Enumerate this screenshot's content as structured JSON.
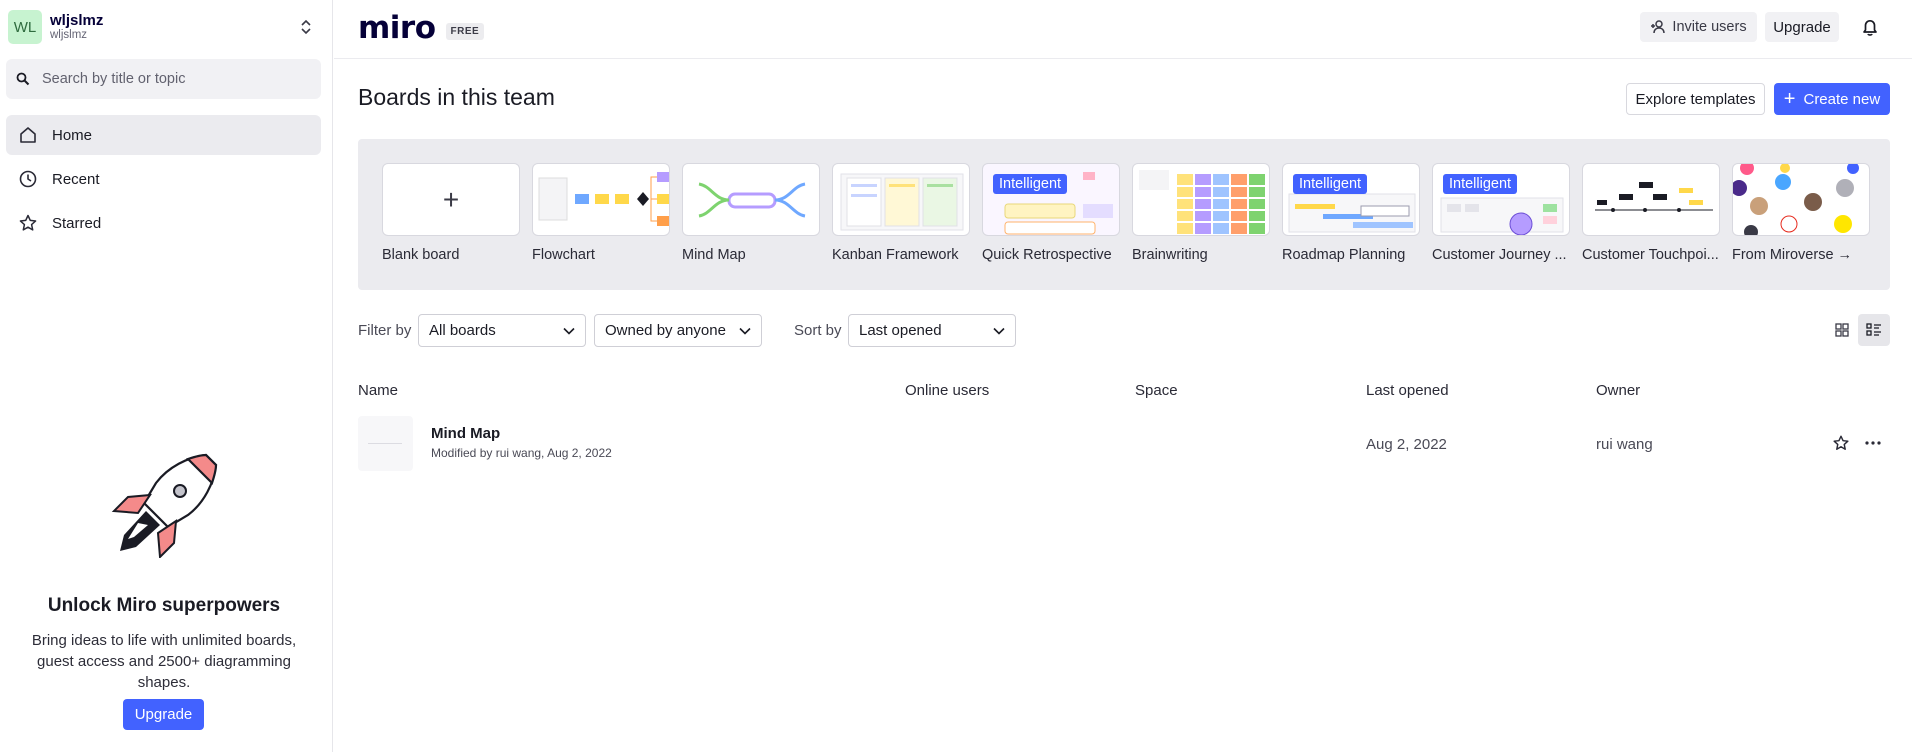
{
  "team": {
    "initials": "WL",
    "name": "wljslmz",
    "handle": "wljslmz"
  },
  "search": {
    "placeholder": "Search by title or topic"
  },
  "nav": [
    {
      "label": "Home",
      "icon": "home-icon",
      "active": true
    },
    {
      "label": "Recent",
      "icon": "clock-icon",
      "active": false
    },
    {
      "label": "Starred",
      "icon": "star-icon",
      "active": false
    }
  ],
  "promo": {
    "title": "Unlock Miro superpowers",
    "text": "Bring ideas to life with unlimited boards, guest access and 2500+ diagramming shapes.",
    "button": "Upgrade"
  },
  "header": {
    "logo": "miro",
    "plan": "FREE",
    "invite": "Invite users",
    "upgrade": "Upgrade"
  },
  "main": {
    "title": "Boards in this team",
    "explore": "Explore templates",
    "create": "Create new"
  },
  "templates": [
    {
      "label": "Blank board"
    },
    {
      "label": "Flowchart"
    },
    {
      "label": "Mind Map"
    },
    {
      "label": "Kanban Framework"
    },
    {
      "label": "Quick Retrospective",
      "badge": "Intelligent"
    },
    {
      "label": "Brainwriting"
    },
    {
      "label": "Roadmap Planning",
      "badge": "Intelligent"
    },
    {
      "label": "Customer Journey ...",
      "badge": "Intelligent"
    },
    {
      "label": "Customer Touchpoi..."
    },
    {
      "label": "From Miroverse →"
    }
  ],
  "filters": {
    "filter_label": "Filter by",
    "boards": "All boards",
    "owner": "Owned by anyone",
    "sort_label": "Sort by",
    "sort": "Last opened"
  },
  "table": {
    "headers": {
      "name": "Name",
      "online": "Online users",
      "space": "Space",
      "last_opened": "Last opened",
      "owner": "Owner"
    },
    "rows": [
      {
        "title": "Mind Map",
        "modified": "Modified by rui wang, Aug 2, 2022",
        "last_opened": "Aug 2, 2022",
        "owner": "rui wang"
      }
    ]
  },
  "colors": {
    "accent": "#4262ff",
    "sidebar_active": "#ebebef",
    "templates_bg": "#ebebef"
  }
}
